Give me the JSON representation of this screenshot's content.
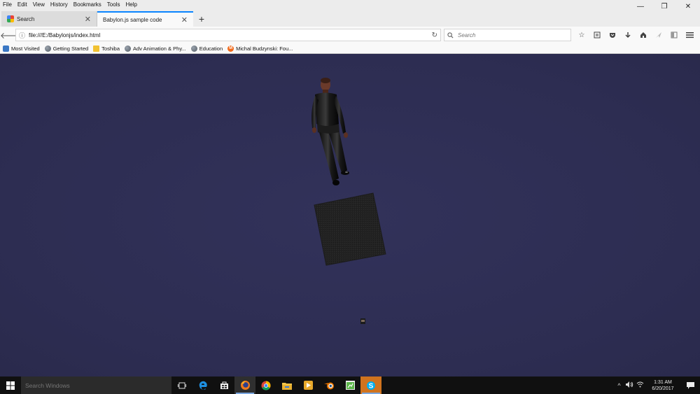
{
  "menubar": {
    "items": [
      "File",
      "Edit",
      "View",
      "History",
      "Bookmarks",
      "Tools",
      "Help"
    ]
  },
  "window_controls": {
    "minimize": "—",
    "maximize": "❐",
    "close": "✕"
  },
  "tabs": [
    {
      "title": "Search",
      "icon": "google-favicon",
      "active": false
    },
    {
      "title": "Babylon.js sample code",
      "icon": "none",
      "active": true
    }
  ],
  "new_tab_label": "+",
  "navigation": {
    "url": "file:///E:/Babylonjs/index.html",
    "search_placeholder": "Search"
  },
  "toolbar_icons": [
    "star-icon",
    "reader-list-icon",
    "pocket-icon",
    "download-icon",
    "home-icon",
    "send-icon",
    "sidebar-icon",
    "hamburger-menu-icon"
  ],
  "bookmarks": [
    {
      "label": "Most Visited",
      "icon": "blue"
    },
    {
      "label": "Getting Started",
      "icon": "globe"
    },
    {
      "label": "Toshiba",
      "icon": "folder"
    },
    {
      "label": "Adv Animation & Phy...",
      "icon": "globe"
    },
    {
      "label": "Education",
      "icon": "globe"
    },
    {
      "label": "Michal Budzynski: Fou...",
      "icon": "m"
    }
  ],
  "scene": {
    "background_color": "#2e2e52",
    "objects": [
      "humanoid-character",
      "dark-cube",
      "small-mesh"
    ]
  },
  "taskbar": {
    "search_placeholder": "Search Windows",
    "apps": [
      "task-view-icon",
      "edge-icon",
      "store-icon",
      "firefox-icon",
      "chrome-icon",
      "file-explorer-icon",
      "media-player-icon",
      "blender-icon",
      "editor-icon",
      "skype-icon"
    ],
    "time": "1:31 AM",
    "date": "6/20/2017"
  },
  "colors": {
    "accent": "#0a84ff",
    "taskbar": "#101010",
    "chrome": "#ececec"
  }
}
